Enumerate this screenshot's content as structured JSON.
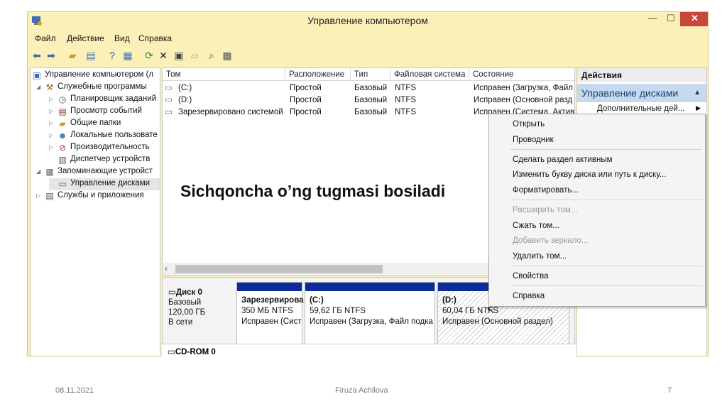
{
  "window": {
    "title": "Управление компьютером"
  },
  "menu": [
    "Файл",
    "Действие",
    "Вид",
    "Справка"
  ],
  "tree": [
    {
      "label": "Управление компьютером (л",
      "icon": "computer-mgmt-icon",
      "arrow": ""
    },
    {
      "label": "Служебные программы",
      "icon": "tools-icon",
      "arrow": "◢"
    },
    {
      "label": "Планировщик заданий",
      "icon": "clock-icon",
      "arrow": "▷"
    },
    {
      "label": "Просмотр событий",
      "icon": "event-viewer-icon",
      "arrow": "▷"
    },
    {
      "label": "Общие папки",
      "icon": "shared-folder-icon",
      "arrow": "▷"
    },
    {
      "label": "Локальные пользовате",
      "icon": "users-icon",
      "arrow": "▷"
    },
    {
      "label": "Производительность",
      "icon": "performance-icon",
      "arrow": "▷"
    },
    {
      "label": "Диспетчер устройств",
      "icon": "device-manager-icon",
      "arrow": ""
    },
    {
      "label": "Запоминающие устройст",
      "icon": "storage-icon",
      "arrow": "◢"
    },
    {
      "label": "Управление дисками",
      "icon": "disk-mgmt-icon",
      "arrow": ""
    },
    {
      "label": "Службы и приложения",
      "icon": "services-icon",
      "arrow": "▷"
    }
  ],
  "volumes": {
    "headers": [
      "Том",
      "Расположение",
      "Тип",
      "Файловая система",
      "Состояние"
    ],
    "rows": [
      [
        "(C:)",
        "Простой",
        "Базовый",
        "NTFS",
        "Исправен (Загрузка, Файл"
      ],
      [
        "(D:)",
        "Простой",
        "Базовый",
        "NTFS",
        "Исправен (Основной разд"
      ],
      [
        "Зарезервировано системой",
        "Простой",
        "Базовый",
        "NTFS",
        "Исправен (Система, Актив"
      ]
    ]
  },
  "disk0": {
    "name": "Диск 0",
    "type": "Базовый",
    "size": "120,00 ГБ",
    "status": "В сети",
    "partitions": [
      {
        "name": "Зарезервирова",
        "size": "350 МБ NTFS",
        "status": "Исправен (Сист"
      },
      {
        "name": "(C:)",
        "size": "59,62 ГБ NTFS",
        "status": "Исправен (Загрузка, Файл подка"
      },
      {
        "name": "(D:)",
        "size": "60,04 ГБ NTFS",
        "status": "Исправен (Основной раздел)"
      }
    ]
  },
  "cdrom": "CD-ROM 0",
  "actions": {
    "header": "Действия",
    "section": "Управление дисками",
    "more": "Дополнительные дей..."
  },
  "context_menu": [
    {
      "label": "Открыть",
      "disabled": false
    },
    {
      "label": "Проводник",
      "disabled": false
    },
    {
      "label": "Сделать раздел активным",
      "disabled": false
    },
    {
      "label": "Изменить букву диска или путь к диску...",
      "disabled": false
    },
    {
      "label": "Форматировать...",
      "disabled": false
    },
    {
      "label": "Расширить том...",
      "disabled": true
    },
    {
      "label": "Сжать том...",
      "disabled": false
    },
    {
      "label": "Добавить зеркало...",
      "disabled": true
    },
    {
      "label": "Удалить том...",
      "disabled": false
    },
    {
      "label": "Свойства",
      "disabled": false
    },
    {
      "label": "Справка",
      "disabled": false
    }
  ],
  "overlay_text": "Sichqoncha o’ng tugmasi bosiladi",
  "footer": {
    "date": "08.11.2021",
    "author": "Firuza Achilova",
    "page": "7"
  }
}
